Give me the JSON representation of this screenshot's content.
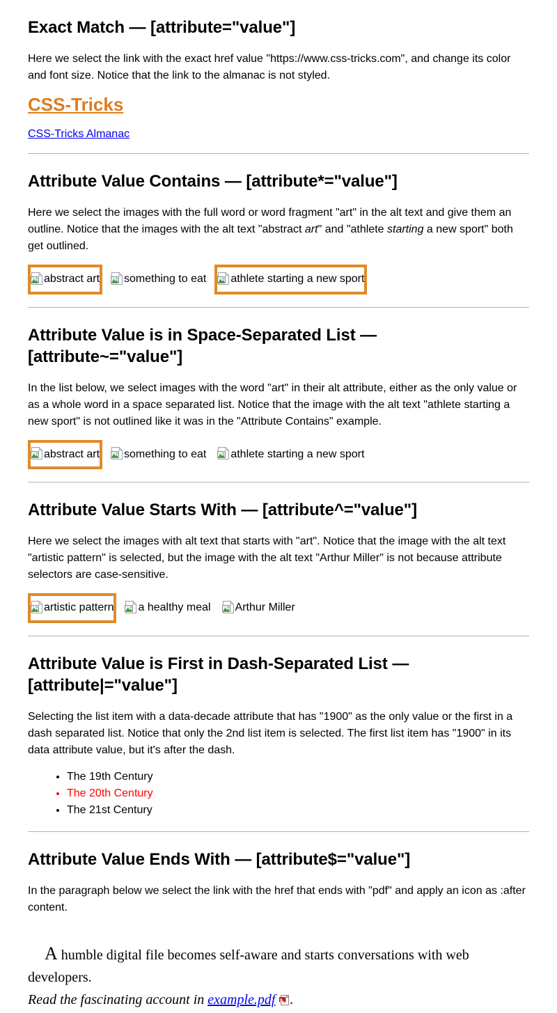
{
  "theme": {
    "accent_orange": "#e07b20",
    "outline_orange": "#e08b27",
    "link_blue": "#0000ee",
    "selected_red": "#ff0000",
    "divider_gray": "#b3b3b3",
    "text_black": "#000000",
    "background": "#ffffff"
  },
  "sections": [
    {
      "id": "exact-match",
      "heading": "Exact Match — [attribute=\"value\"]",
      "paragraph": "Here we select the link with the exact href value \"https://www.css-tricks.com\", and change its color and font size. Notice that the link to the almanac is not styled.",
      "exact_link_label": "CSS-Tricks",
      "almanac_link_label": "CSS-Tricks Almanac"
    },
    {
      "id": "contains",
      "heading": "Attribute Value Contains — [attribute*=\"value\"]",
      "paragraph_part1": "Here we select the images with the full word or word fragment \"art\" in the alt text and give them an outline. Notice that the images with the alt text \"abstract ",
      "paragraph_em1": "art",
      "paragraph_part2": "\" and \"athlete ",
      "paragraph_em2": "starting",
      "paragraph_part3": " a new sport\" both get outlined.",
      "images": [
        {
          "alt": "abstract art",
          "outlined": true
        },
        {
          "alt": "something to eat",
          "outlined": false
        },
        {
          "alt": "athlete starting a new sport",
          "outlined": true
        }
      ]
    },
    {
      "id": "space-separated",
      "heading": "Attribute Value is in Space-Separated List — [attribute~=\"value\"]",
      "paragraph": "In the list below, we select images with the word \"art\" in their alt attribute, either as the only value or as a whole word in a space separated list. Notice that the image with the alt text \"athlete starting a new sport\" is not outlined like it was in the \"Attribute Contains\" example.",
      "images": [
        {
          "alt": "abstract art",
          "outlined": true
        },
        {
          "alt": "something to eat",
          "outlined": false
        },
        {
          "alt": "athlete starting a new sport",
          "outlined": false
        }
      ]
    },
    {
      "id": "starts-with",
      "heading": "Attribute Value Starts With — [attribute^=\"value\"]",
      "paragraph": "Here we select the images with alt text that starts with \"art\". Notice that the image with the alt text \"artistic pattern\" is selected, but the image with the alt text \"Arthur Miller\" is not because attribute selectors are case-sensitive.",
      "images": [
        {
          "alt": "artistic pattern",
          "outlined": true
        },
        {
          "alt": "a healthy meal",
          "outlined": false
        },
        {
          "alt": "Arthur Miller",
          "outlined": false
        }
      ]
    },
    {
      "id": "dash-separated",
      "heading": "Attribute Value is First in Dash-Separated List — [attribute|=\"value\"]",
      "paragraph": "Selecting the list item with a data-decade attribute that has \"1900\" as the only value or the first in a dash separated list. Notice that only the 2nd list item is selected. The first list item has \"1900\" in its data attribute value, but it's after the dash.",
      "list_items": [
        {
          "label": "The 19th Century",
          "selected": false
        },
        {
          "label": "The 20th Century",
          "selected": true
        },
        {
          "label": "The 21st Century",
          "selected": false
        }
      ]
    },
    {
      "id": "ends-with",
      "heading": "Attribute Value Ends With — [attribute$=\"value\"]",
      "paragraph": "In the paragraph below we select the link with the href that ends with \"pdf\" and apply an icon as :after content.",
      "story_dropcap": "A",
      "story_line1": " humble digital file becomes self-aware and starts conversations with web developers.",
      "story_line2_prefix": "Read the fascinating account in ",
      "story_pdf_link": "example.pdf",
      "story_line2_suffix": "."
    }
  ],
  "icons": {
    "broken_image": "broken-image-icon",
    "pdf": "pdf-file-icon"
  }
}
